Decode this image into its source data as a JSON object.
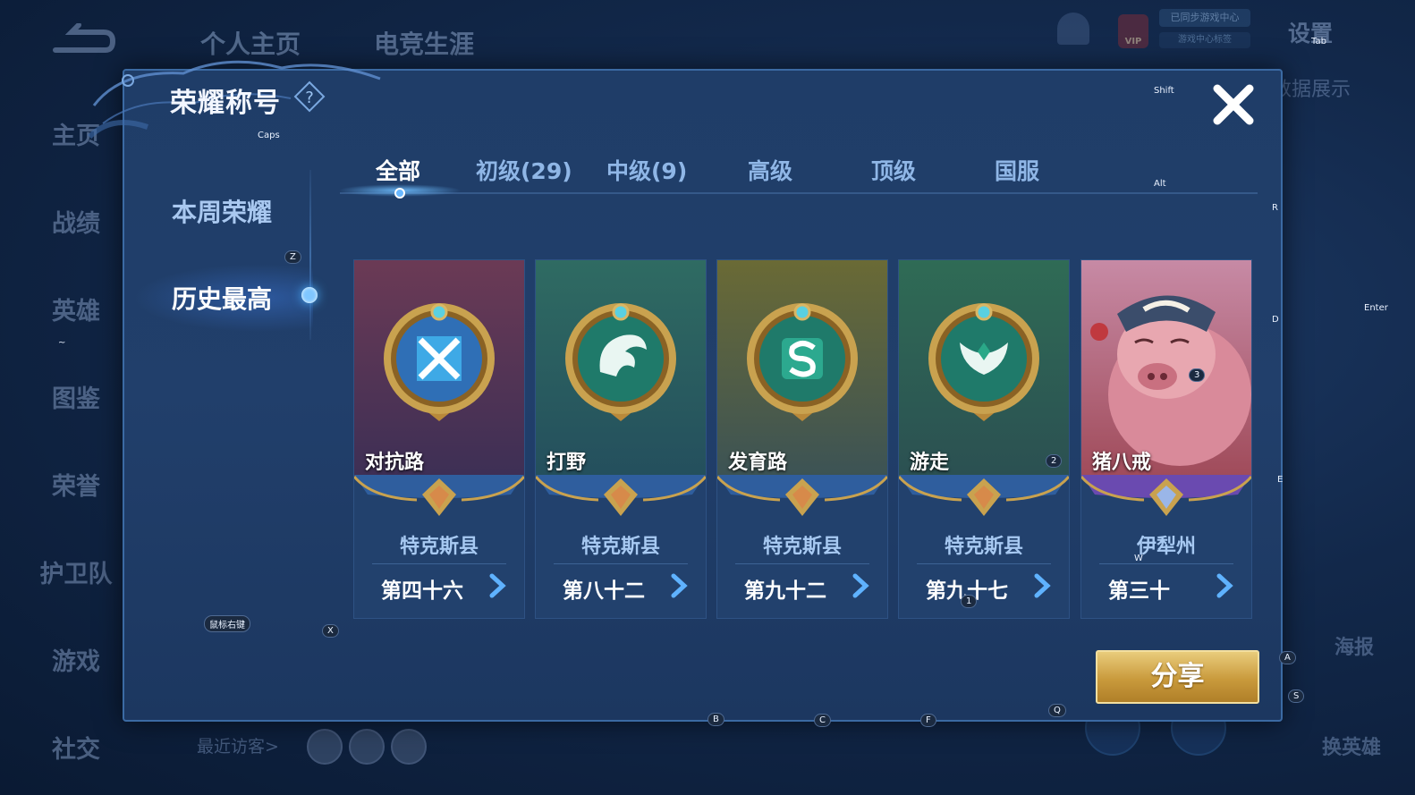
{
  "background": {
    "top_tabs": [
      "个人主页",
      "电竞生涯"
    ],
    "side_nav": [
      "主页",
      "战绩",
      "英雄",
      "图鉴",
      "荣誉",
      "护卫队",
      "游戏",
      "社交"
    ],
    "settings_label": "设置",
    "data_show_label": "数据展示",
    "vip_label": "VIP",
    "promo_line1": "已同步游戏中心",
    "promo_line2": "游戏中心标签",
    "recent_visitors_label": "最近访客>",
    "right_labels": [
      "海报",
      "换英雄"
    ]
  },
  "modal": {
    "title": "荣耀称号",
    "left_menu": [
      {
        "label": "本周荣耀",
        "active": false
      },
      {
        "label": "历史最高",
        "active": true
      }
    ],
    "tabs": [
      {
        "label": "全部",
        "active": true
      },
      {
        "label": "初级(29)",
        "active": false
      },
      {
        "label": "中级(9)",
        "active": false
      },
      {
        "label": "高级",
        "active": false
      },
      {
        "label": "顶级",
        "active": false
      },
      {
        "label": "国服",
        "active": false
      }
    ],
    "cards": [
      {
        "role": "对抗路",
        "region": "特克斯县",
        "rank": "第四十六",
        "icon": "crossed-swords-emblem-icon",
        "bg_top": "#6b3a55",
        "bg_bottom": "#3d2f55",
        "badge": "bronze"
      },
      {
        "role": "打野",
        "region": "特克斯县",
        "rank": "第八十二",
        "icon": "dragon-emblem-icon",
        "bg_top": "#2f6b62",
        "bg_bottom": "#244f5d",
        "badge": "bronze"
      },
      {
        "role": "发育路",
        "region": "特克斯县",
        "rank": "第九十二",
        "icon": "s-emblem-icon",
        "bg_top": "#6a6a35",
        "bg_bottom": "#3c5355",
        "badge": "bronze"
      },
      {
        "role": "游走",
        "region": "特克斯县",
        "rank": "第九十七",
        "icon": "wings-emblem-icon",
        "bg_top": "#2f6b55",
        "bg_bottom": "#2b5052",
        "badge": "bronze"
      },
      {
        "role": "猪八戒",
        "region": "伊犁州",
        "rank": "第三十",
        "icon": "zhu-bajie-portrait",
        "bg_top": "#c78aa5",
        "bg_bottom": "#a04b5a",
        "badge": "purple"
      }
    ],
    "share_label": "分享"
  },
  "key_hints": [
    {
      "id": "caps",
      "label": "Caps"
    },
    {
      "id": "shift",
      "label": "Shift"
    },
    {
      "id": "tab",
      "label": "Tab"
    },
    {
      "id": "alt",
      "label": "Alt"
    },
    {
      "id": "enter",
      "label": "Enter"
    },
    {
      "id": "z",
      "label": "Z"
    },
    {
      "id": "x",
      "label": "X"
    },
    {
      "id": "r",
      "label": "R"
    },
    {
      "id": "d",
      "label": "D"
    },
    {
      "id": "e",
      "label": "E"
    },
    {
      "id": "a",
      "label": "A"
    },
    {
      "id": "s",
      "label": "S"
    },
    {
      "id": "w",
      "label": "W"
    },
    {
      "id": "q",
      "label": "Q"
    },
    {
      "id": "b",
      "label": "B"
    },
    {
      "id": "c",
      "label": "C"
    },
    {
      "id": "f",
      "label": "F"
    },
    {
      "id": "k1",
      "label": "1"
    },
    {
      "id": "k2",
      "label": "2"
    },
    {
      "id": "k3",
      "label": "3"
    },
    {
      "id": "tilde",
      "label": "~"
    },
    {
      "id": "rmb",
      "label": "鼠标右键"
    }
  ]
}
